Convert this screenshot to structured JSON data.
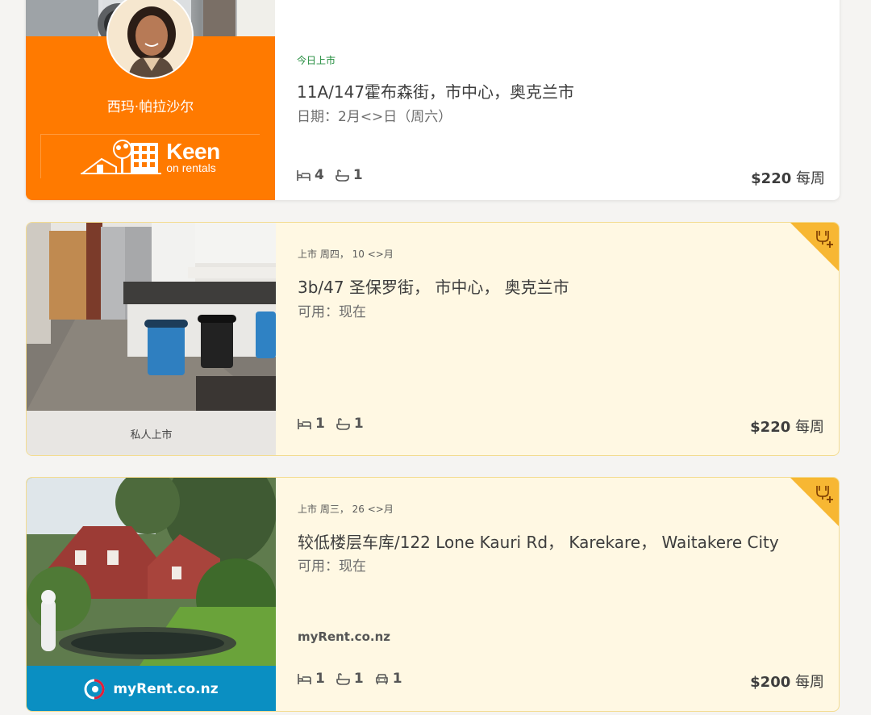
{
  "listings": [
    {
      "listed": "今日上市",
      "title": "11A/147霍布森街，市中心，奥克兰市",
      "availability": "日期：2月<>日（周六）",
      "agent_name": "西玛·帕拉沙尔",
      "agency_logo": {
        "line1": "Keen",
        "line2": "on rentals"
      },
      "beds": "4",
      "baths": "1",
      "price": "$220",
      "price_unit": "每周"
    },
    {
      "listed": "上市 周四， 10 <>月",
      "title": "3b/47 圣保罗街， 市中心， 奥克兰市",
      "availability": "可用：现在",
      "footer_label": "私人上市",
      "beds": "1",
      "baths": "1",
      "price": "$220",
      "price_unit": "每周"
    },
    {
      "listed": "上市 周三， 26 <>月",
      "title": "较低楼层车库/122 Lone Kauri Rd， Karekare， Waitakere City",
      "availability": "可用：现在",
      "source": "myRent.co.nz",
      "footer_logo": "myRent.co.nz",
      "beds": "1",
      "baths": "1",
      "parking": "1",
      "price": "$200",
      "price_unit": "每周"
    }
  ],
  "icons": {
    "bed": "bed-icon",
    "bath": "bath-icon",
    "car": "car-icon",
    "shortlist": "shortlist-add-icon"
  },
  "colors": {
    "keen_orange": "#ff7a00",
    "highlight_bg": "#fff8e3",
    "corner_badge": "#f7b733",
    "myrent_blue": "#0a8fc2",
    "listed_today": "#1f8a3a"
  }
}
